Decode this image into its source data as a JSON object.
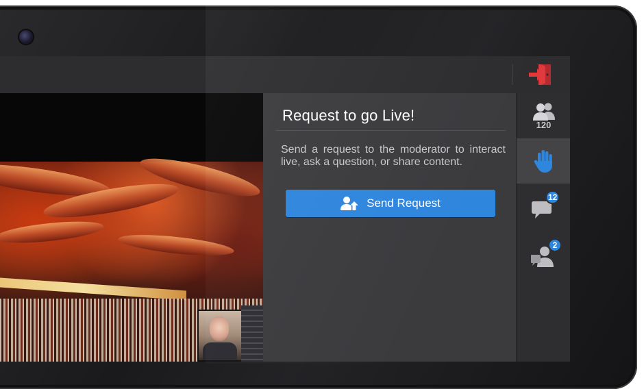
{
  "panel": {
    "title": "Request to go Live!",
    "description": "Send a request to the moderator to interact live, ask a question, or share content.",
    "send_label": "Send Request"
  },
  "rail": {
    "participants_count": "120",
    "chat_badge": "12",
    "requests_badge": "2"
  },
  "icons": {
    "exit": "exit-door-icon",
    "participants": "participants-icon",
    "raise_hand": "raise-hand-icon",
    "chat": "chat-bubble-icon",
    "requests": "user-request-icon",
    "send": "user-upload-icon"
  },
  "colors": {
    "accent": "#2f86dd",
    "exit": "#e03a3e",
    "panel_bg": "#3b3b3e",
    "rail_bg": "#2e2e31"
  }
}
